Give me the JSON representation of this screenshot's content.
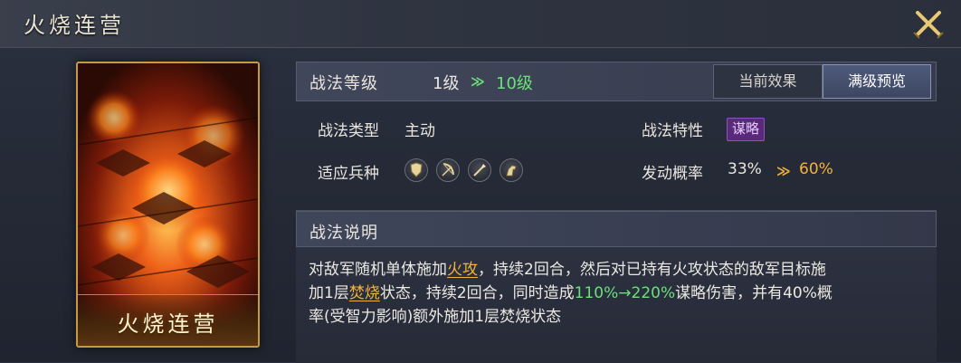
{
  "window": {
    "title": "火烧连营",
    "close_icon": "close-crossed-swords-icon"
  },
  "card": {
    "name": "火烧连营"
  },
  "level": {
    "label": "战法等级",
    "current": "1级",
    "arrow": "≫",
    "max": "10级"
  },
  "tabs": [
    {
      "label": "当前效果",
      "selected": false
    },
    {
      "label": "满级预览",
      "selected": true
    }
  ],
  "info": {
    "type_label": "战法类型",
    "type_value": "主动",
    "trait_label": "战法特性",
    "trait_value": "谋略",
    "units_label": "适应兵种",
    "units": [
      "shield-icon",
      "bow-icon",
      "spear-icon",
      "horse-icon"
    ],
    "chance_label": "发动概率",
    "chance_current": "33%",
    "chance_arrow": "≫",
    "chance_max": "60%"
  },
  "description": {
    "title": "战法说明",
    "seg1": "对敌军随机单体施加",
    "hl1": "火攻",
    "seg2": "，持续2回合，然后对已持有火攻状态的敌军目标施",
    "seg3": "加1层",
    "hl2": "焚烧",
    "seg4": "状态，持续2回合，同时造成",
    "hl3": "110%→220%",
    "seg5": "谋略伤害，并有40%概",
    "seg6": "率(受智力影响)额外施加1层焚烧状态"
  },
  "colors": {
    "accent_green": "#6be07a",
    "accent_orange": "#f5b13a",
    "badge_purple": "#5a2a7a",
    "card_border": "#c89a3e"
  }
}
